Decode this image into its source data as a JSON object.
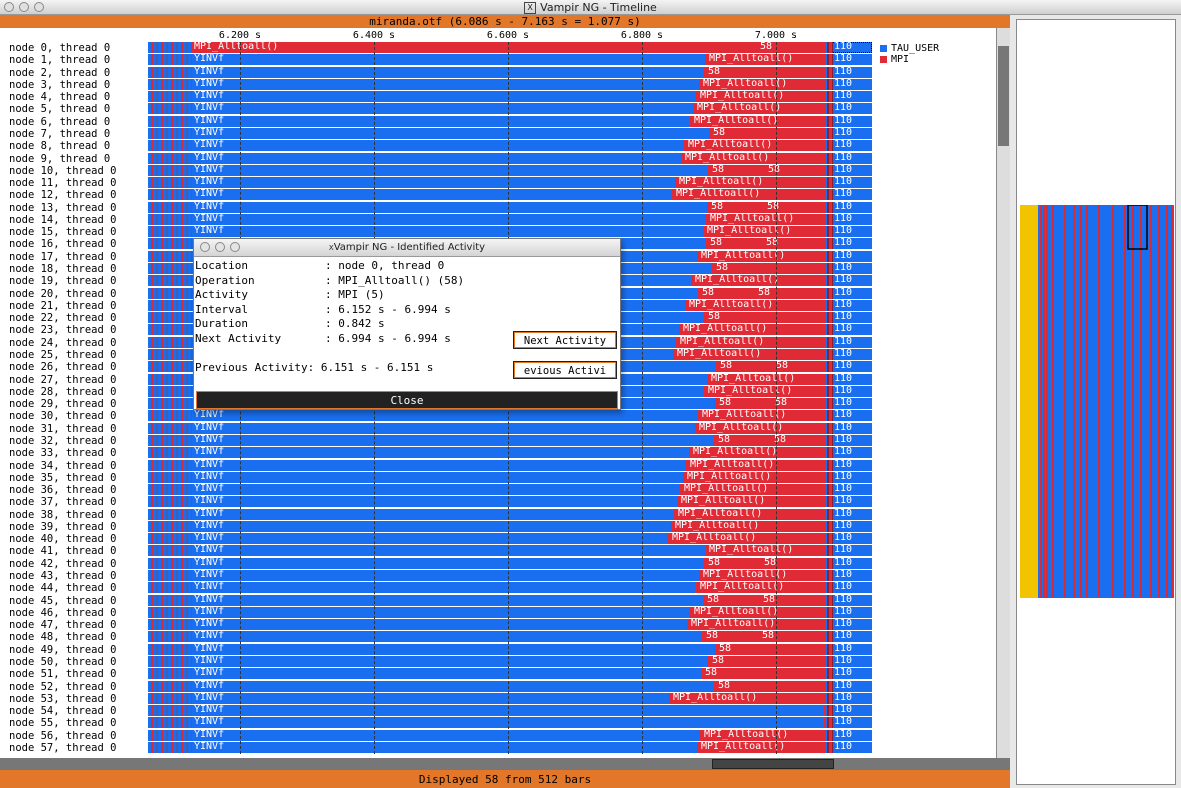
{
  "window": {
    "title": "Vampir NG - Timeline"
  },
  "timeline": {
    "header": "miranda.otf (6.086 s - 7.163 s = 1.077 s)",
    "ticks": [
      "6.200 s",
      "6.400 s",
      "6.600 s",
      "6.800 s",
      "7.000 s"
    ],
    "status": "Displayed 58 from 512 bars",
    "legend": [
      {
        "label": "TAU_USER",
        "color": "#1a6ff0"
      },
      {
        "label": "MPI",
        "color": "#e02a35"
      }
    ],
    "rows": [
      {
        "label": "node 0, thread 0",
        "mpi": "MPI_Alltoall()",
        "mpi2": "58",
        "value": "110",
        "selected": true
      },
      {
        "label": "node 1, thread 0",
        "mpi": "MPI_Alltoall()",
        "value": "110"
      },
      {
        "label": "node 2, thread 0",
        "mpi": "58",
        "value": "110"
      },
      {
        "label": "node 3, thread 0",
        "mpi": "MPI_Alltoall()",
        "value": "110"
      },
      {
        "label": "node 4, thread 0",
        "mpi": "MPI_Alltoall()",
        "value": "110"
      },
      {
        "label": "node 5, thread 0",
        "mpi": "MPI_Alltoall()",
        "value": "110"
      },
      {
        "label": "node 6, thread 0",
        "mpi": "MPI_Alltoall()",
        "value": "110"
      },
      {
        "label": "node 7, thread 0",
        "mpi": "58",
        "value": "110"
      },
      {
        "label": "node 8, thread 0",
        "mpi": "MPI_Alltoall()",
        "value": "110"
      },
      {
        "label": "node 9, thread 0",
        "mpi": "MPI_Alltoall()",
        "value": "110"
      },
      {
        "label": "node 10, thread 0",
        "mpi": "58",
        "mpi2": "58",
        "value": "110"
      },
      {
        "label": "node 11, thread 0",
        "mpi": "MPI_Alltoall()",
        "value": "110"
      },
      {
        "label": "node 12, thread 0",
        "mpi": "MPI_Alltoall()",
        "value": "110"
      },
      {
        "label": "node 13, thread 0",
        "mpi": "58",
        "mpi2": "58",
        "value": "110"
      },
      {
        "label": "node 14, thread 0",
        "mpi": "MPI_Alltoall()",
        "value": "110"
      },
      {
        "label": "node 15, thread 0",
        "mpi": "MPI_Alltoall()",
        "value": "110"
      },
      {
        "label": "node 16, thread 0",
        "mpi": "58",
        "mpi2": "58",
        "value": "110"
      },
      {
        "label": "node 17, thread 0",
        "mpi": "MPI_Alltoall()",
        "value": "110"
      },
      {
        "label": "node 18, thread 0",
        "mpi": "58",
        "value": "110"
      },
      {
        "label": "node 19, thread 0",
        "mpi": "MPI_Alltoall()",
        "value": "110"
      },
      {
        "label": "node 20, thread 0",
        "mpi": "58",
        "mpi2": "58",
        "value": "110"
      },
      {
        "label": "node 21, thread 0",
        "mpi": "MPI_Alltoall()",
        "value": "110"
      },
      {
        "label": "node 22, thread 0",
        "mpi": "58",
        "value": "110"
      },
      {
        "label": "node 23, thread 0",
        "mpi": "MPI_Alltoall()",
        "value": "110"
      },
      {
        "label": "node 24, thread 0",
        "mpi": "MPI_Alltoall()",
        "value": "110"
      },
      {
        "label": "node 25, thread 0",
        "mpi": "MPI_Alltoall()",
        "value": "110"
      },
      {
        "label": "node 26, thread 0",
        "mpi": "58",
        "mpi2": "58",
        "value": "110"
      },
      {
        "label": "node 27, thread 0",
        "mpi": "MPI_Alltoall()",
        "value": "110"
      },
      {
        "label": "node 28, thread 0",
        "mpi": "MPI_Alltoall()",
        "value": "110"
      },
      {
        "label": "node 29, thread 0",
        "mpi": "58",
        "mpi2": "58",
        "value": "110"
      },
      {
        "label": "node 30, thread 0",
        "mpi": "MPI_Alltoall()",
        "value": "110"
      },
      {
        "label": "node 31, thread 0",
        "mpi": "MPI_Alltoall()",
        "value": "110"
      },
      {
        "label": "node 32, thread 0",
        "mpi": "58",
        "mpi2": "58",
        "value": "110"
      },
      {
        "label": "node 33, thread 0",
        "mpi": "MPI_Alltoall()",
        "value": "110"
      },
      {
        "label": "node 34, thread 0",
        "mpi": "MPI_Alltoall()",
        "value": "110"
      },
      {
        "label": "node 35, thread 0",
        "mpi": "MPI_Alltoall()",
        "value": "110"
      },
      {
        "label": "node 36, thread 0",
        "mpi": "MPI_Alltoall()",
        "value": "110"
      },
      {
        "label": "node 37, thread 0",
        "mpi": "MPI_Alltoall()",
        "value": "110"
      },
      {
        "label": "node 38, thread 0",
        "mpi": "MPI_Alltoall()",
        "value": "110"
      },
      {
        "label": "node 39, thread 0",
        "mpi": "MPI_Alltoall()",
        "value": "110"
      },
      {
        "label": "node 40, thread 0",
        "mpi": "MPI_Alltoall()",
        "value": "110"
      },
      {
        "label": "node 41, thread 0",
        "mpi": "MPI_Alltoall()",
        "value": "110"
      },
      {
        "label": "node 42, thread 0",
        "mpi": "58",
        "mpi2": "58",
        "value": "110"
      },
      {
        "label": "node 43, thread 0",
        "mpi": "MPI_Alltoall()",
        "value": "110"
      },
      {
        "label": "node 44, thread 0",
        "mpi": "MPI_Alltoall()",
        "value": "110"
      },
      {
        "label": "node 45, thread 0",
        "mpi": "58",
        "mpi2": "58",
        "value": "110"
      },
      {
        "label": "node 46, thread 0",
        "mpi": "MPI_Alltoall()",
        "value": "110"
      },
      {
        "label": "node 47, thread 0",
        "mpi": "MPI_Alltoall()",
        "value": "110"
      },
      {
        "label": "node 48, thread 0",
        "mpi": "58",
        "mpi2": "58",
        "value": "110"
      },
      {
        "label": "node 49, thread 0",
        "mpi": "58",
        "value": "110"
      },
      {
        "label": "node 50, thread 0",
        "mpi": "58",
        "value": "110"
      },
      {
        "label": "node 51, thread 0",
        "mpi": "58",
        "value": "110"
      },
      {
        "label": "node 52, thread 0",
        "mpi": "58",
        "value": "110"
      },
      {
        "label": "node 53, thread 0",
        "mpi": "MPI_Alltoall()",
        "value": "110"
      },
      {
        "label": "node 54, thread 0",
        "mpi": "",
        "value": "110"
      },
      {
        "label": "node 55, thread 0",
        "mpi": "",
        "value": "110"
      },
      {
        "label": "node 56, thread 0",
        "mpi": "MPI_Alltoall()",
        "value": "110"
      },
      {
        "label": "node 57, thread 0",
        "mpi": "MPI_Alltoall()",
        "value": "110"
      }
    ],
    "row_user_label": "YINVf"
  },
  "dialog": {
    "title": "Vampir NG - Identified Activity",
    "fields": [
      {
        "label": "Location",
        "value": ": node 0, thread 0"
      },
      {
        "label": "Operation",
        "value": ": MPI_Alltoall()   (58)"
      },
      {
        "label": "Activity",
        "value": ": MPI (5)"
      },
      {
        "label": "Interval",
        "value": ": 6.152 s - 6.994 s"
      },
      {
        "label": "Duration",
        "value": ": 0.842 s"
      },
      {
        "label": "Next Activity",
        "value": ": 6.994 s - 6.994 s"
      }
    ],
    "previous": "Previous Activity: 6.151 s - 6.151 s",
    "next_button": "Next Activity",
    "prev_button": "evious Activi",
    "close_button": "Close"
  }
}
